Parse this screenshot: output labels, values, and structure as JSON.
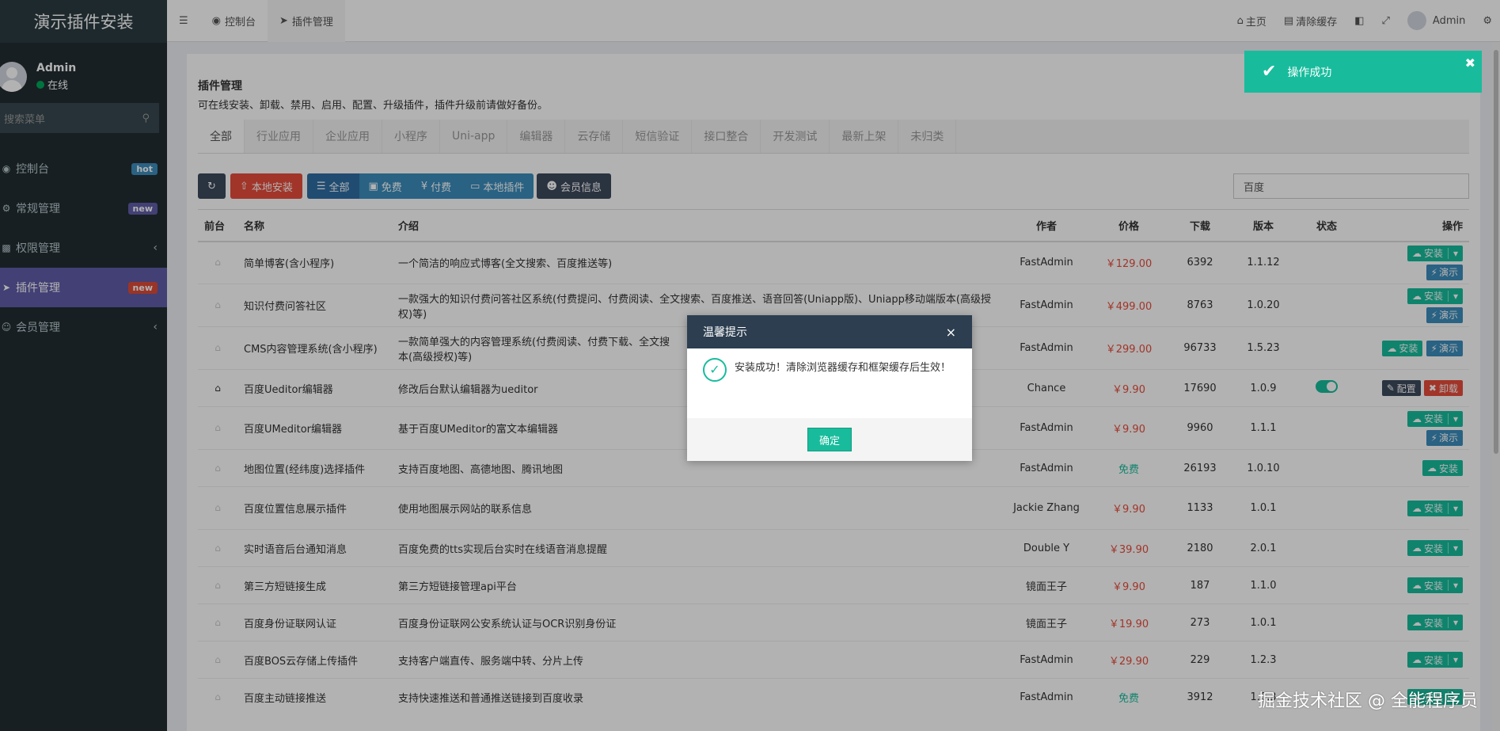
{
  "sidebar": {
    "logo": "演示插件安装",
    "user_name": "Admin",
    "user_status": "在线",
    "search_placeholder": "搜索菜单",
    "items": [
      {
        "icon": "dashboard-icon",
        "label": "控制台",
        "badge": "hot"
      },
      {
        "icon": "cogs-icon",
        "label": "常规管理",
        "badge": "new"
      },
      {
        "icon": "group-icon",
        "label": "权限管理",
        "badge": ""
      },
      {
        "icon": "rocket-icon",
        "label": "插件管理",
        "badge": "new"
      },
      {
        "icon": "user-circle-icon",
        "label": "会员管理",
        "badge": ""
      }
    ]
  },
  "topbar": {
    "tabs": [
      {
        "icon": "dashboard-icon",
        "label": "控制台"
      },
      {
        "icon": "rocket-icon",
        "label": "插件管理"
      }
    ],
    "home": "主页",
    "clear_cache": "清除缓存",
    "admin": "Admin"
  },
  "page": {
    "title": "插件管理",
    "desc": "可在线安装、卸载、禁用、启用、配置、升级插件，插件升级前请做好备份。",
    "tabs": [
      "全部",
      "行业应用",
      "企业应用",
      "小程序",
      "Uni-app",
      "编辑器",
      "云存储",
      "短信验证",
      "接口整合",
      "开发测试",
      "最新上架",
      "未归类"
    ],
    "toolbar": {
      "local_install": "本地安装",
      "all": "全部",
      "free": "免费",
      "paid": "付费",
      "local_plugins": "本地插件",
      "member_info": "会员信息",
      "search_value": "百度"
    },
    "columns": [
      "前台",
      "名称",
      "介绍",
      "作者",
      "价格",
      "下载",
      "版本",
      "状态",
      "操作"
    ],
    "rows": [
      {
        "name": "简单博客(含小程序)",
        "intro": "一个简洁的响应式博客(全文搜索、百度推送等)",
        "author": "FastAdmin",
        "price": "￥129.00",
        "downloads": "6392",
        "version": "1.1.12",
        "ops": "install_demo"
      },
      {
        "name": "知识付费问答社区",
        "intro": "一款强大的知识付费问答社区系统(付费提问、付费阅读、全文搜索、百度推送、语音回答(Uniapp版)、Uniapp移动端版本(高级授权)等)",
        "author": "FastAdmin",
        "price": "￥499.00",
        "downloads": "8763",
        "version": "1.0.20",
        "ops": "install_demo"
      },
      {
        "name": "CMS内容管理系统(含小程序)",
        "intro": "一款简单强大的内容管理系统(付费阅读、付费下载、全文搜",
        "intro_tail": "本(高级授权)等)",
        "author": "FastAdmin",
        "price": "￥299.00",
        "downloads": "96733",
        "version": "1.5.23",
        "ops": "install_demo_inline"
      },
      {
        "name": "百度Ueditor编辑器",
        "intro": "修改后台默认编辑器为ueditor",
        "author": "Chance",
        "price": "￥9.90",
        "downloads": "17690",
        "version": "1.0.9",
        "ops": "config_uninstall"
      },
      {
        "name": "百度UMeditor编辑器",
        "intro": "基于百度UMeditor的富文本编辑器",
        "author": "FastAdmin",
        "price": "￥9.90",
        "downloads": "9960",
        "version": "1.1.1",
        "ops": "install_demo"
      },
      {
        "name": "地图位置(经纬度)选择插件",
        "intro": "支持百度地图、高德地图、腾讯地图",
        "author": "FastAdmin",
        "price": "免费",
        "downloads": "26193",
        "version": "1.0.10",
        "ops": "install_plain"
      },
      {
        "name": "百度位置信息展示插件",
        "intro": "使用地图展示网站的联系信息",
        "author": "Jackie Zhang",
        "price": "￥9.90",
        "downloads": "1133",
        "version": "1.0.1",
        "ops": "install"
      },
      {
        "name": "实时语音后台通知消息",
        "intro": "百度免费的tts实现后台实时在线语音消息提醒",
        "author": "Double Y",
        "price": "￥39.90",
        "downloads": "2180",
        "version": "2.0.1",
        "ops": "install"
      },
      {
        "name": "第三方短链接生成",
        "intro": "第三方短链接管理api平台",
        "author": "镜面王子",
        "price": "￥9.90",
        "downloads": "187",
        "version": "1.1.0",
        "ops": "install"
      },
      {
        "name": "百度身份证联网认证",
        "intro": "百度身份证联网公安系统认证与OCR识别身份证",
        "author": "镜面王子",
        "price": "￥19.90",
        "downloads": "273",
        "version": "1.0.1",
        "ops": "install"
      },
      {
        "name": "百度BOS云存储上传插件",
        "intro": "支持客户端直传、服务端中转、分片上传",
        "author": "FastAdmin",
        "price": "￥29.90",
        "downloads": "229",
        "version": "1.2.3",
        "ops": "install"
      },
      {
        "name": "百度主动链接推送",
        "intro": "支持快速推送和普通推送链接到百度收录",
        "author": "FastAdmin",
        "price": "免费",
        "downloads": "3912",
        "version": "1.0.3",
        "ops": "install"
      }
    ],
    "op_labels": {
      "install": "安装",
      "demo": "演示",
      "config": "配置",
      "uninstall": "卸载"
    }
  },
  "toast": {
    "text": "操作成功"
  },
  "modal": {
    "title": "温馨提示",
    "message": "安装成功！清除浏览器缓存和框架缓存后生效！",
    "ok": "确定"
  },
  "watermark": "掘金技术社区 @ 全能程序员",
  "colors": {
    "accent": "#18bc9c",
    "danger": "#e74c3c",
    "primary": "#3c8dbc",
    "sidebar": "#222d32"
  }
}
